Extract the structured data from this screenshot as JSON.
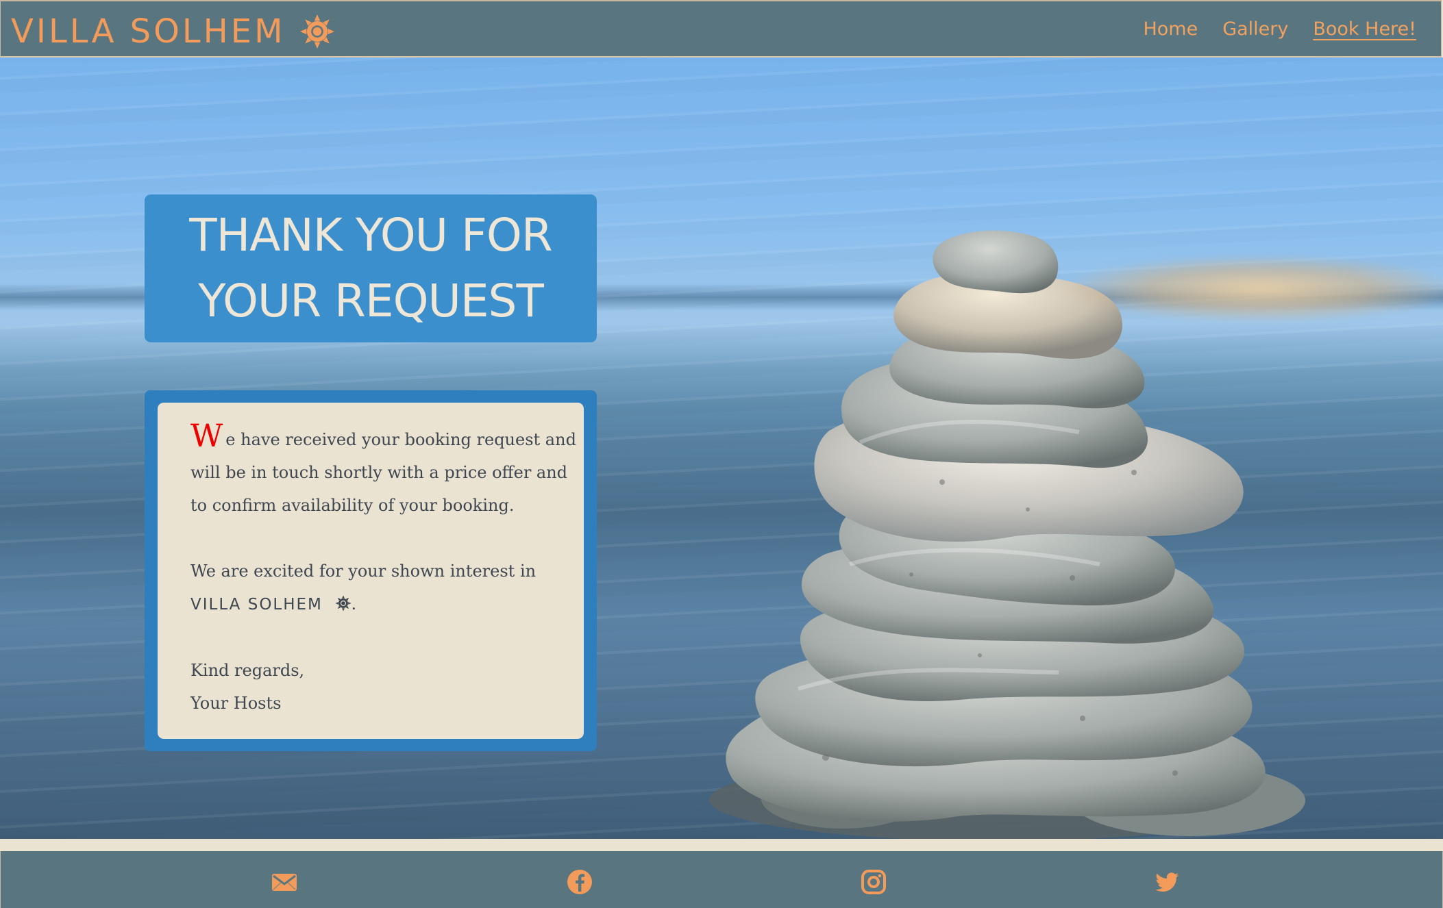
{
  "brand": {
    "name": "VILLA SOLHEM",
    "icon": "sun-icon",
    "color": "#f29b5a"
  },
  "nav": {
    "items": [
      {
        "label": "Home"
      },
      {
        "label": "Gallery"
      },
      {
        "label": "Book Here!"
      }
    ]
  },
  "hero": {
    "title_line_1": "THANK YOU FOR",
    "title_line_2": "YOUR REQUEST"
  },
  "message": {
    "drop_cap": "W",
    "line_1_rest": "e have received your booking request and",
    "line_2": "will be in touch shortly with a price offer and",
    "line_3": "to confirm availability of your booking.",
    "line_4": "We are excited for your shown interest in",
    "brand_name": "VILLA SOLHEM",
    "period": ".",
    "line_6": "Kind regards,",
    "line_7": "Your Hosts"
  },
  "footer": {
    "icons": [
      "envelope-icon",
      "facebook-icon",
      "instagram-icon",
      "twitter-icon"
    ]
  },
  "colors": {
    "navbar": "#587580",
    "accent": "#f29b5a",
    "title_box": "#3c8fcd",
    "message_border": "#2f7fbe",
    "card": "#ebe3d2",
    "drop_cap": "#ef0000"
  }
}
